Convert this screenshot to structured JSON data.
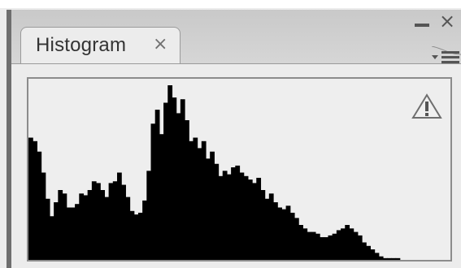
{
  "panel": {
    "tab_label": "Histogram",
    "tab_close_glyph": "×",
    "minimize_icon": "minimize-icon",
    "close_icon": "close-icon",
    "close_glyph": "×",
    "menu_icon": "panel-menu-icon",
    "warning_icon": "warning-icon"
  },
  "colors": {
    "panel_bg": "#d8d8d8",
    "content_bg": "#ececec",
    "histogram_fill": "#000000",
    "border": "#8c8c8c"
  },
  "histogram": {
    "levels": [
      0.7,
      0.68,
      0.62,
      0.5,
      0.35,
      0.25,
      0.33,
      0.4,
      0.38,
      0.3,
      0.3,
      0.32,
      0.38,
      0.37,
      0.4,
      0.45,
      0.44,
      0.4,
      0.36,
      0.44,
      0.45,
      0.5,
      0.43,
      0.36,
      0.28,
      0.26,
      0.27,
      0.34,
      0.51,
      0.78,
      0.86,
      0.72,
      0.9,
      1.0,
      0.93,
      0.84,
      0.92,
      0.8,
      0.68,
      0.7,
      0.64,
      0.68,
      0.58,
      0.62,
      0.55,
      0.48,
      0.51,
      0.49,
      0.53,
      0.54,
      0.5,
      0.48,
      0.46,
      0.44,
      0.47,
      0.4,
      0.35,
      0.38,
      0.33,
      0.3,
      0.29,
      0.31,
      0.27,
      0.24,
      0.2,
      0.18,
      0.16,
      0.16,
      0.15,
      0.13,
      0.13,
      0.14,
      0.15,
      0.17,
      0.18,
      0.2,
      0.18,
      0.16,
      0.14,
      0.1,
      0.08,
      0.06,
      0.04,
      0.02,
      0.01,
      0.01,
      0.01,
      0.01,
      0.0,
      0.0,
      0.0,
      0.0,
      0.0,
      0.0,
      0.0,
      0.0,
      0.0,
      0.0,
      0.0,
      0.0
    ]
  }
}
